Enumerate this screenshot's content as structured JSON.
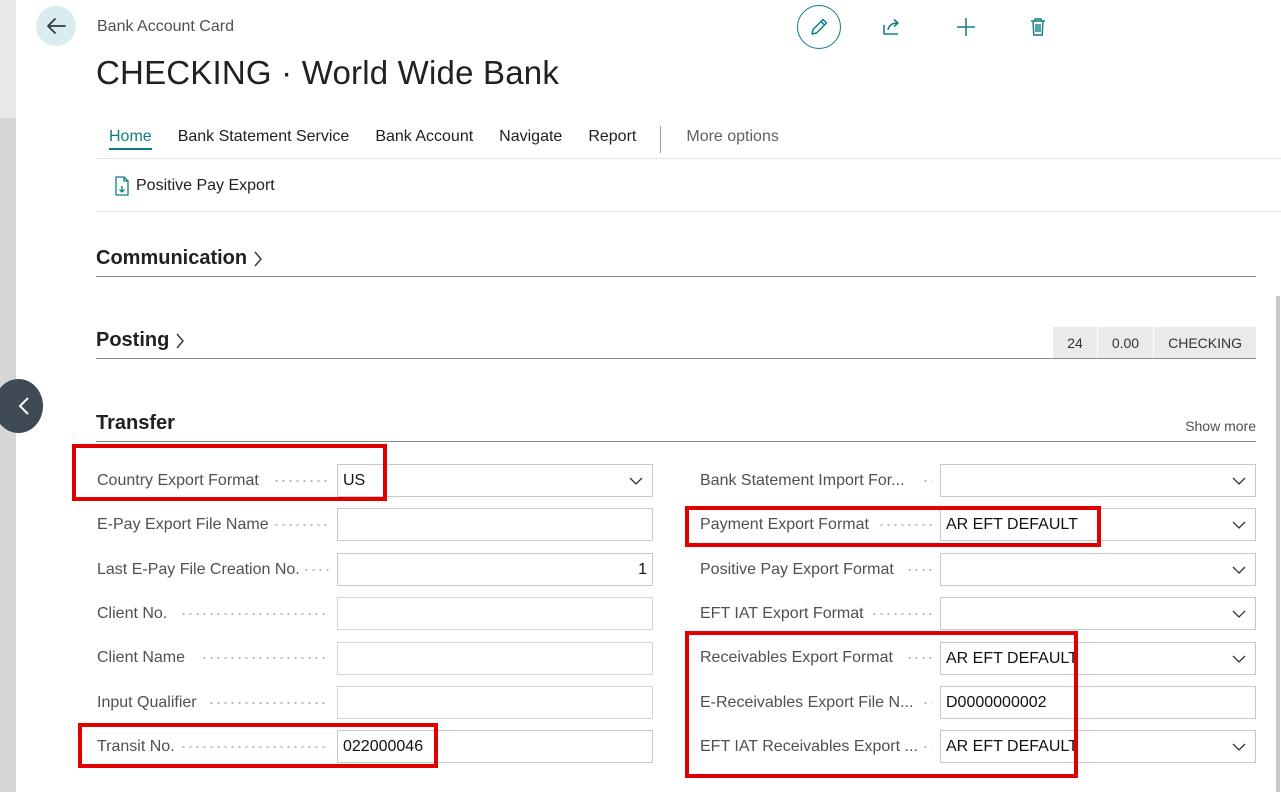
{
  "header": {
    "breadcrumb": "Bank Account Card",
    "title": "CHECKING · World Wide Bank"
  },
  "menu": {
    "items": [
      "Home",
      "Bank Statement Service",
      "Bank Account",
      "Navigate",
      "Report"
    ],
    "more": "More options"
  },
  "actions": {
    "positive_pay_export": "Positive Pay Export"
  },
  "sections": {
    "communication": "Communication",
    "posting": "Posting",
    "posting_summary": [
      "24",
      "0.00",
      "CHECKING"
    ],
    "transfer": "Transfer",
    "show_more": "Show more"
  },
  "transfer_left": [
    {
      "label": "Country Export Format",
      "value": "US",
      "type": "dropdown"
    },
    {
      "label": "E-Pay Export File Name",
      "value": "",
      "type": "text"
    },
    {
      "label": "Last E-Pay File Creation No.",
      "value": "1",
      "type": "number"
    },
    {
      "label": "Client No.",
      "value": "",
      "type": "readonly"
    },
    {
      "label": "Client Name",
      "value": "",
      "type": "readonly"
    },
    {
      "label": "Input Qualifier",
      "value": "",
      "type": "readonly"
    },
    {
      "label": "Transit No.",
      "value": "022000046",
      "type": "text"
    }
  ],
  "transfer_right": [
    {
      "label": "Bank Statement Import For...",
      "value": "",
      "type": "dropdown"
    },
    {
      "label": "Payment Export Format",
      "value": "AR EFT DEFAULT",
      "type": "dropdown"
    },
    {
      "label": "Positive Pay Export Format",
      "value": "",
      "type": "dropdown"
    },
    {
      "label": "EFT IAT Export Format",
      "value": "",
      "type": "dropdown"
    },
    {
      "label": "Receivables Export Format",
      "value": "AR EFT DEFAULT",
      "type": "dropdown"
    },
    {
      "label": "E-Receivables Export File N...",
      "value": "D0000000002",
      "type": "text"
    },
    {
      "label": "EFT IAT Receivables Export ...",
      "value": "AR EFT DEFAULT",
      "type": "dropdown"
    }
  ],
  "colors": {
    "accent": "#0e7c86",
    "highlight": "#e00000"
  }
}
